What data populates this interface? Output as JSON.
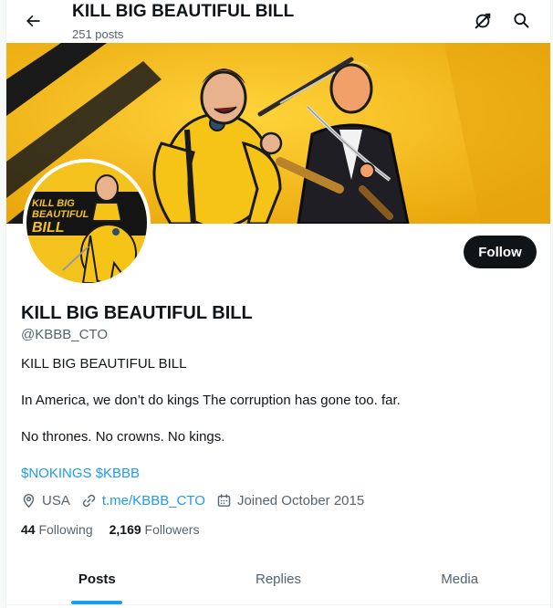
{
  "header": {
    "title": "KILL BIG BEAUTIFUL BILL",
    "posts_count": "251 posts"
  },
  "avatar": {
    "text_lines": [
      "KILL BIG",
      "BEAUTIFUL",
      "BILL"
    ]
  },
  "profile": {
    "follow_label": "Follow",
    "name": "KILL BIG BEAUTIFUL BILL",
    "handle": "@KBBB_CTO",
    "bio_line1": "KILL BIG BEAUTIFUL BILL",
    "bio_line2": "In America, we don’t do kings The corruption has gone too. far.",
    "bio_line3": "No thrones. No crowns. No kings.",
    "cashtag1": "$NOKINGS",
    "cashtag2": "$KBBB",
    "location": "USA",
    "link": "t.me/KBBB_CTO",
    "joined": "Joined October 2015",
    "following_count": "44",
    "following_label": "Following",
    "followers_count": "2,169",
    "followers_label": "Followers"
  },
  "tabs": [
    {
      "label": "Posts"
    },
    {
      "label": "Replies"
    },
    {
      "label": "Media"
    }
  ],
  "colors": {
    "accent": "#1d9bf0",
    "text": "#0f1419",
    "muted": "#536471",
    "banner_yellow": "#f3b712"
  }
}
